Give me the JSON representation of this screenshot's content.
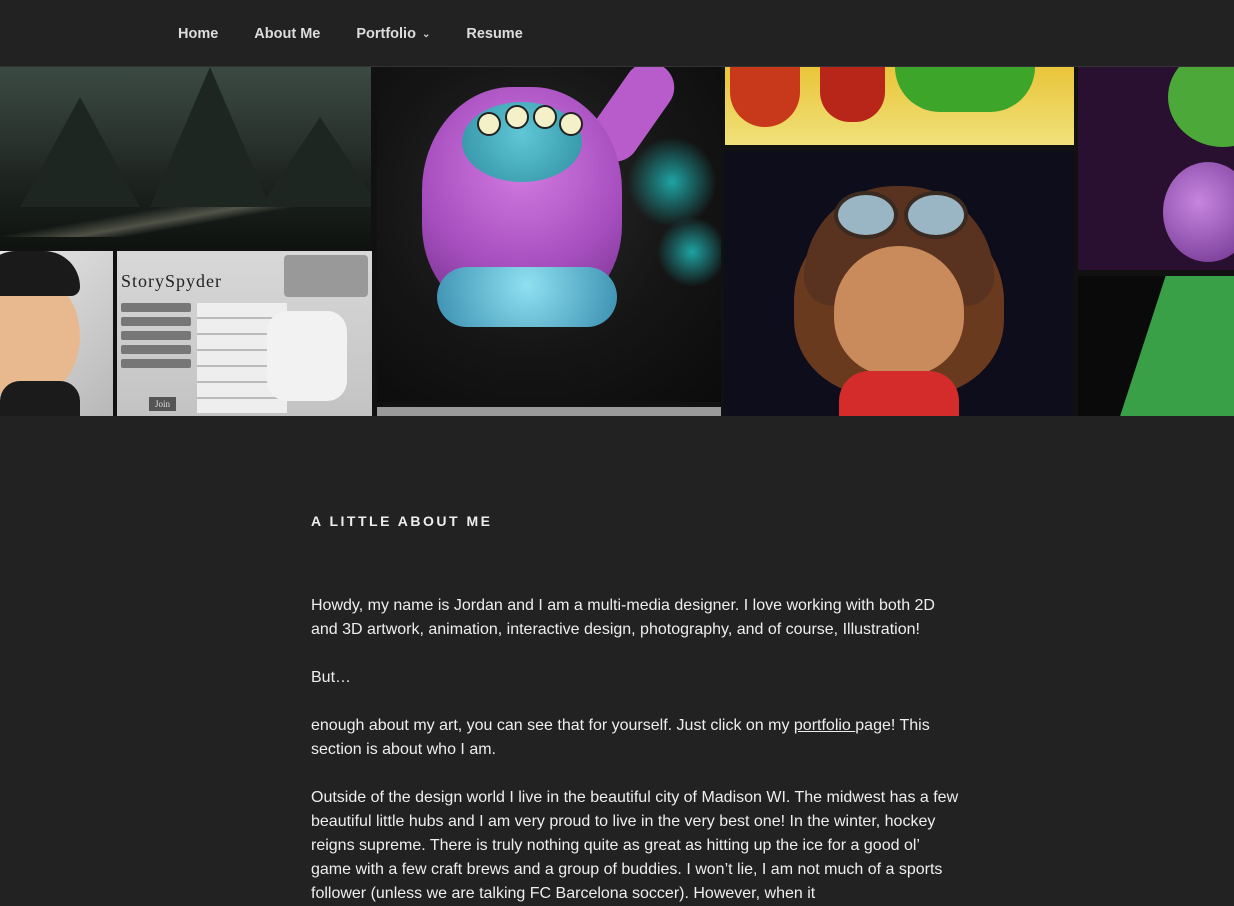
{
  "nav": {
    "items": [
      {
        "label": "Home"
      },
      {
        "label": "About Me"
      },
      {
        "label": "Portfolio",
        "has_dropdown": true
      },
      {
        "label": "Resume"
      }
    ]
  },
  "hero": {
    "storyspyder_logo": "StorySpyder",
    "join_label": "Join"
  },
  "section": {
    "title": "A LITTLE ABOUT ME",
    "p1": "Howdy, my name is Jordan and I am a multi-media designer. I love working with both 2D and 3D artwork,  animation, interactive design, photography, and of course, Illustration!",
    "p2": "But…",
    "p3_before": "enough about my art, you can see that for yourself. Just click on my ",
    "p3_link": "portfolio ",
    "p3_after": "page! This section is about who I am.",
    "p4": "Outside of the design world I live in the beautiful city of Madison WI. The midwest has a few beautiful little hubs and I am very proud to live in the very best one! In the winter, hockey reigns supreme. There is truly nothing quite as great as hitting up the ice for a good ol’ game with a few craft brews and a group of buddies. I won’t lie, I am not much of a sports follower (unless we are talking FC Barcelona soccer). However, when it"
  },
  "colors": {
    "background": "#222222",
    "text": "#eeeeee"
  }
}
